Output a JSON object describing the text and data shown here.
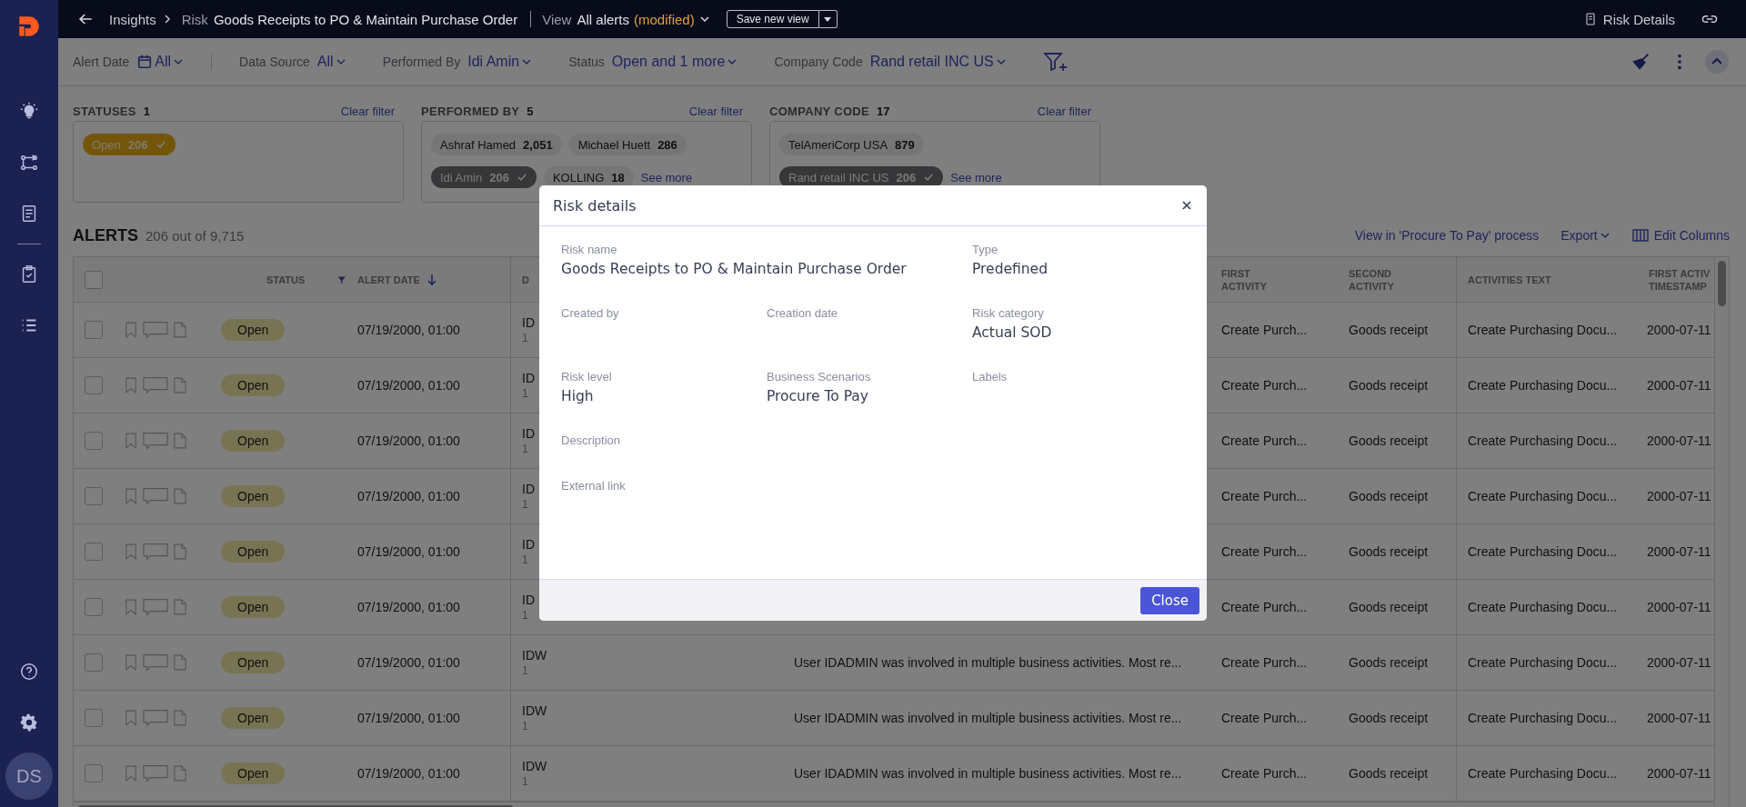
{
  "sidebar": {
    "avatar": "DS"
  },
  "top_bar": {
    "breadcrumb": [
      {
        "text": "Insights",
        "kind": "link"
      },
      {
        "text": "Risk",
        "kind": "muted"
      },
      {
        "text": "Goods Receipts to PO & Maintain Purchase Order",
        "kind": "title"
      }
    ],
    "view_label": "View",
    "view_name": "All alerts",
    "view_modifier": "(modified)",
    "save_button": "Save new view",
    "risk_details": "Risk Details"
  },
  "filter_bar": [
    {
      "label": "Alert Date",
      "value": "All",
      "kind": "date"
    },
    {
      "label": "Data Source",
      "value": "All",
      "kind": "plain"
    },
    {
      "label": "Performed By",
      "value": "Idi Amin",
      "kind": "plain"
    },
    {
      "label": "Status",
      "value": "Open and 1 more",
      "kind": "plain"
    },
    {
      "label": "Company Code",
      "value": "Rand retail INC US",
      "kind": "plain"
    }
  ],
  "filter_cards": [
    {
      "title": "STATUSES",
      "count": "1",
      "clear": "Clear filter",
      "kind": "status",
      "chips": [
        {
          "label": "Open",
          "count": "206",
          "selected": true
        }
      ]
    },
    {
      "title": "PERFORMED BY",
      "count": "5",
      "clear": "Clear filter",
      "kind": "plain",
      "see_more": "See more",
      "chips": [
        {
          "label": "Ashraf Hamed",
          "count": "2,051",
          "selected": false
        },
        {
          "label": "Michael Huett",
          "count": "286",
          "selected": false
        },
        {
          "label": "Idi Amin",
          "count": "206",
          "selected": true
        },
        {
          "label": "KOLLING",
          "count": "18",
          "selected": false
        }
      ]
    },
    {
      "title": "COMPANY CODE",
      "count": "17",
      "clear": "Clear filter",
      "kind": "plain",
      "see_more": "See more",
      "chips": [
        {
          "label": "TelAmeriCorp USA",
          "count": "879",
          "selected": false
        },
        {
          "label": "Rand retail INC US",
          "count": "206",
          "selected": true
        }
      ]
    }
  ],
  "alerts": {
    "title": "ALERTS",
    "count": "206 out of 9,715",
    "process_link": "View in 'Procure To Pay' process",
    "export": "Export",
    "edit_columns": "Edit Columns"
  },
  "table": {
    "select_all_checked": false,
    "columns": [
      {
        "label": "STATUS",
        "kind": "filter"
      },
      {
        "label": "ALERT DATE",
        "kind": "sorted"
      },
      {
        "label": "D"
      },
      {
        "label": "FIRST ACTIVITY"
      },
      {
        "label": "SECOND ACTIVITY"
      },
      {
        "label": "ACTIVITIES TEXT"
      },
      {
        "label": "FIRST ACTIV TIMESTAMP"
      }
    ],
    "rows": [
      {
        "checked": false,
        "status": "Open",
        "date": "07/19/2000, 01:00",
        "source": "ID",
        "source_sub": "1",
        "first_activity": "Create Purch...",
        "second_activity": "Goods receipt",
        "activities_text": "Create Purchasing Docu...",
        "first_timestamp": "2000-07-11"
      },
      {
        "checked": false,
        "status": "Open",
        "date": "07/19/2000, 01:00",
        "source": "ID",
        "source_sub": "1",
        "first_activity": "Create Purch...",
        "second_activity": "Goods receipt",
        "activities_text": "Create Purchasing Docu...",
        "first_timestamp": "2000-07-11"
      },
      {
        "checked": false,
        "status": "Open",
        "date": "07/19/2000, 01:00",
        "source": "ID",
        "source_sub": "1",
        "first_activity": "Create Purch...",
        "second_activity": "Goods receipt",
        "activities_text": "Create Purchasing Docu...",
        "first_timestamp": "2000-07-11"
      },
      {
        "checked": false,
        "status": "Open",
        "date": "07/19/2000, 01:00",
        "source": "ID",
        "source_sub": "1",
        "first_activity": "Create Purch...",
        "second_activity": "Goods receipt",
        "activities_text": "Create Purchasing Docu...",
        "first_timestamp": "2000-07-11"
      },
      {
        "checked": false,
        "status": "Open",
        "date": "07/19/2000, 01:00",
        "source": "ID",
        "source_sub": "1",
        "first_activity": "Create Purch...",
        "second_activity": "Goods receipt",
        "activities_text": "Create Purchasing Docu...",
        "first_timestamp": "2000-07-11"
      },
      {
        "checked": false,
        "status": "Open",
        "date": "07/19/2000, 01:00",
        "source": "ID",
        "source_sub": "1",
        "first_activity": "Create Purch...",
        "second_activity": "Goods receipt",
        "activities_text": "Create Purchasing Docu...",
        "first_timestamp": "2000-07-11"
      },
      {
        "checked": false,
        "status": "Open",
        "date": "07/19/2000, 01:00",
        "source": "IDW",
        "source_sub": "1",
        "description": "User IDADMIN was involved in multiple business activities. Most re...",
        "first_activity": "Create Purch...",
        "second_activity": "Goods receipt",
        "activities_text": "Create Purchasing Docu...",
        "first_timestamp": "2000-07-11"
      },
      {
        "checked": false,
        "status": "Open",
        "date": "07/19/2000, 01:00",
        "source": "IDW",
        "source_sub": "1",
        "description": "User IDADMIN was involved in multiple business activities. Most re...",
        "first_activity": "Create Purch...",
        "second_activity": "Goods receipt",
        "activities_text": "Create Purchasing Docu...",
        "first_timestamp": "2000-07-11"
      },
      {
        "checked": false,
        "status": "Open",
        "date": "07/19/2000, 01:00",
        "source": "IDW",
        "source_sub": "1",
        "description": "User IDADMIN was involved in multiple business activities. Most re...",
        "first_activity": "Create Purch...",
        "second_activity": "Goods receipt",
        "activities_text": "Create Purchasing Docu...",
        "first_timestamp": "2000-07-11"
      }
    ]
  },
  "modal": {
    "title": "Risk details",
    "close_button": "Close",
    "fields": [
      {
        "label": "Risk name",
        "value": "Goods Receipts to PO & Maintain Purchase Order",
        "kind": "wide"
      },
      {
        "label": "Type",
        "value": "Predefined",
        "kind": "normal"
      },
      {
        "label": "Created by",
        "kind": "normal"
      },
      {
        "label": "Creation date",
        "kind": "normal"
      },
      {
        "label": "Risk category",
        "value": "Actual SOD",
        "kind": "normal"
      },
      {
        "label": "Risk level",
        "value": "High",
        "kind": "normal"
      },
      {
        "label": "Business Scenarios",
        "value": "Procure To Pay",
        "kind": "normal"
      },
      {
        "label": "Labels",
        "kind": "normal"
      },
      {
        "label": "Description",
        "kind": "full"
      },
      {
        "label": "External link",
        "kind": "full"
      }
    ]
  }
}
